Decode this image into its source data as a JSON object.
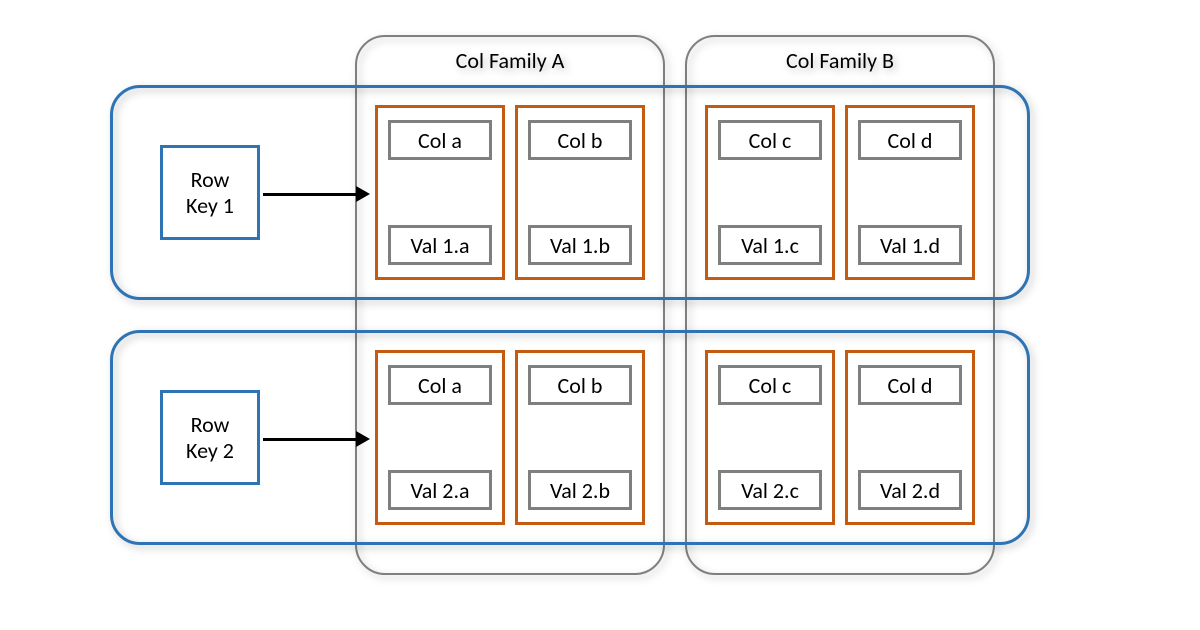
{
  "col_families": {
    "a": {
      "title": "Col Family A"
    },
    "b": {
      "title": "Col Family B"
    }
  },
  "rows": {
    "1": {
      "key_label": "Row\nKey 1",
      "cells": {
        "a": {
          "col": "Col a",
          "val": "Val 1.a"
        },
        "b": {
          "col": "Col b",
          "val": "Val 1.b"
        },
        "c": {
          "col": "Col c",
          "val": "Val 1.c"
        },
        "d": {
          "col": "Col d",
          "val": "Val 1.d"
        }
      }
    },
    "2": {
      "key_label": "Row\nKey 2",
      "cells": {
        "a": {
          "col": "Col a",
          "val": "Val 2.a"
        },
        "b": {
          "col": "Col b",
          "val": "Val 2.b"
        },
        "c": {
          "col": "Col c",
          "val": "Val 2.c"
        },
        "d": {
          "col": "Col d",
          "val": "Val 2.d"
        }
      }
    }
  }
}
